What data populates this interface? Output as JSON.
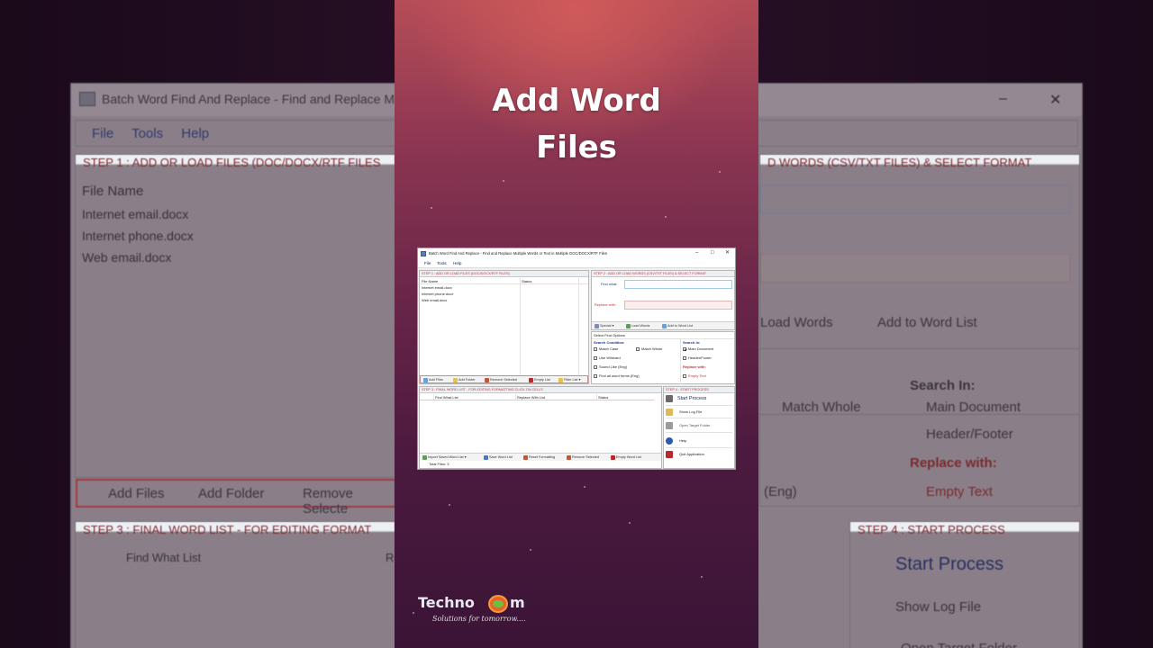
{
  "caption": {
    "line1": "Add Word",
    "line2": "Files"
  },
  "bg": {
    "title": "Batch Word Find And Replace  - Find and Replace Multi",
    "menu": [
      "File",
      "Tools",
      "Help"
    ],
    "step1": "STEP 1 : ADD OR LOAD FILES (DOC/DOCX/RTF FILES",
    "file_name_header": "File Name",
    "files": [
      "Internet email.docx",
      "Internet phone.docx",
      "Web email.docx"
    ],
    "add_files": "Add Files",
    "add_folder": "Add Folder",
    "remove_selected": "Remove Selecte",
    "step3": "STEP 3 : FINAL WORD LIST - FOR EDITING FORMAT",
    "find_what_list": "Find What List",
    "re_col": "Re",
    "step2": "D WORDS (CSV/TXT FILES) & SELECT FORMAT",
    "load_words": "Load Words",
    "add_to_word_list": "Add to Word List",
    "search_in": "Search In:",
    "match_whole": "Match Whole",
    "main_document": "Main Document",
    "header_footer": "Header/Footer",
    "replace_with": "Replace with:",
    "eng": "(Eng)",
    "empty_text": "Empty Text",
    "step4": "STEP 4 : START PROCESS",
    "start_process": "Start Process",
    "show_log_file": "Show Log File",
    "open_target_folder": "Open Target Folder"
  },
  "app": {
    "title": "Batch Word Find And Replace - Find and Replace Multiple Words or Text  in Multiple DOC/DOCX/RTF Files",
    "window_controls": {
      "minimize": "–",
      "maximize": "□",
      "close": "✕"
    },
    "menu": {
      "file": "File",
      "tools": "Tools",
      "help": "Help"
    },
    "step1": {
      "header": "STEP 1 : ADD OR LOAD FILES (DOC/DOCX/RTF FILES)",
      "col_file_name": "File Name",
      "col_status": "Status",
      "files": [
        "Internet email.docx",
        "Internet phone.docx",
        "Web email.docx"
      ],
      "buttons": {
        "add_files": "Add Files",
        "add_folder": "Add Folder",
        "remove_selected": "Remove Selected",
        "empty_list": "Empty List",
        "filter_list": "Filter List"
      }
    },
    "step2": {
      "header": "STEP 2 : ADD OR LOAD WORDS (CSV/TXT FILES) & SELECT FORMAT",
      "find_what": "Find what:",
      "replace_with": "Replace with:",
      "buttons": {
        "special": "Special",
        "load_words": "Load Words",
        "add_to_word_list": "Add to Word List"
      }
    },
    "options": {
      "header": "Select Find Options",
      "search_condition": "Search Condition:",
      "search_in": "Search In:",
      "match_case": "Match Case",
      "match_whole": "Match Whole",
      "main_document": "Main Document",
      "use_wildcard": "Use Wildcard",
      "header_footer": "Header/Footer",
      "sound_like": "Sound Like (Eng)",
      "replace_with": "Replace with:",
      "find_all_forms": "Find all word forms (Eng)",
      "empty_text": "Empty Text"
    },
    "step3": {
      "header": "STEP 3 : FINAL WORD LIST - FOR EDITING FORMATTING CLICK ON CELLS",
      "col_find": "Find What List",
      "col_replace": "Replace With List",
      "col_status": "Status",
      "buttons": {
        "import": "Import Saved Word List",
        "save": "Save Word List",
        "reset": "Reset Formatting",
        "remove": "Remove Selected",
        "empty": "Empty Word List"
      },
      "total_files": "Total Files: 3"
    },
    "step4": {
      "header": "STEP 4 : START PROCESS",
      "start_process": "Start Process",
      "show_log_file": "Show Log File",
      "open_target_folder": "Open Target Folder",
      "help": "Help",
      "quit": "Quit Application"
    }
  },
  "brand": {
    "name": "Techno",
    "tagline": "Solutions for tomorrow...."
  }
}
